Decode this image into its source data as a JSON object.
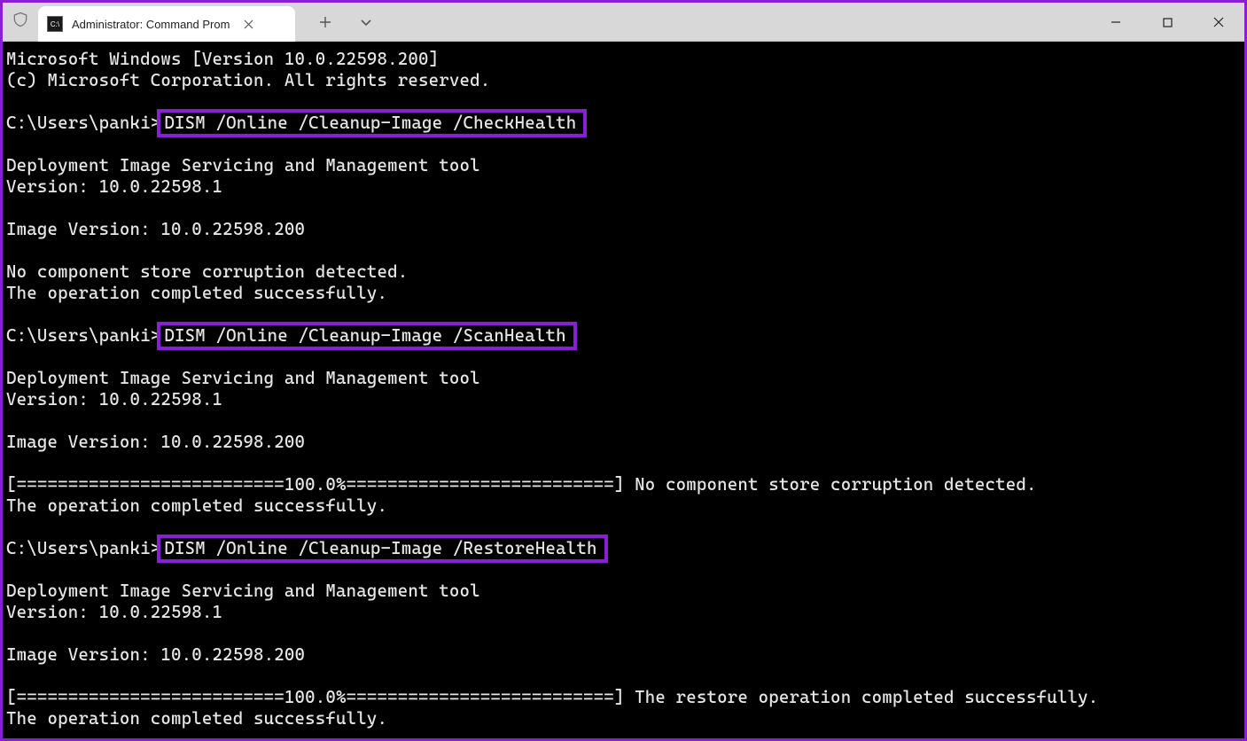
{
  "tab": {
    "title": "Administrator: Command Prom"
  },
  "terminal": {
    "line0": "Microsoft Windows [Version 10.0.22598.200]",
    "line1": "(c) Microsoft Corporation. All rights reserved.",
    "blank": "",
    "prompt1": "C:\\Users\\panki>",
    "cmd1": "DISM /Online /Cleanup-Image /CheckHealth",
    "dismTool": "Deployment Image Servicing and Management tool",
    "dismVer": "Version: 10.0.22598.1",
    "imageVer": "Image Version: 10.0.22598.200",
    "noCorrupt": "No component store corruption detected.",
    "opComplete": "The operation completed successfully.",
    "prompt2": "C:\\Users\\panki>",
    "cmd2": "DISM /Online /Cleanup-Image /ScanHealth",
    "progressNoCorrupt": "[==========================100.0%==========================] No component store corruption detected.",
    "prompt3": "C:\\Users\\panki>",
    "cmd3": "DISM /Online /Cleanup-Image /RestoreHealth",
    "progressRestore": "[==========================100.0%==========================] The restore operation completed successfully."
  }
}
